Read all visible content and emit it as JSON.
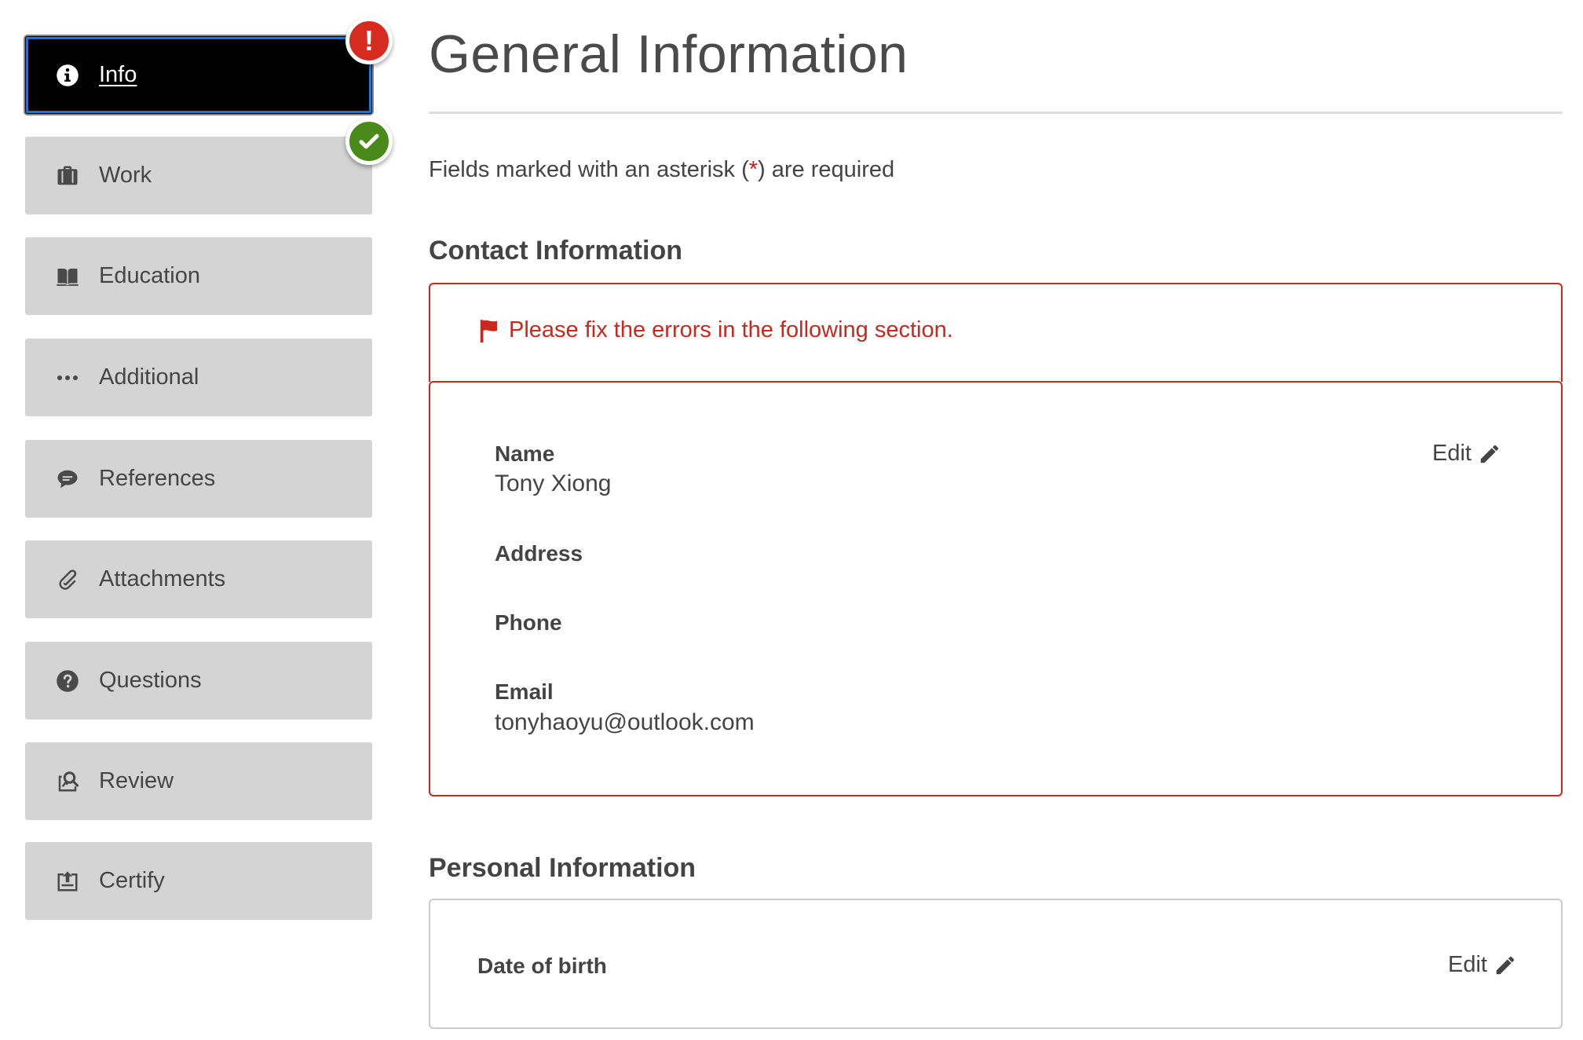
{
  "sidebar": {
    "items": [
      {
        "label": "Info",
        "icon": "info-icon",
        "state": "active"
      },
      {
        "label": "Work",
        "icon": "briefcase-icon"
      },
      {
        "label": "Education",
        "icon": "book-icon"
      },
      {
        "label": "Additional",
        "icon": "ellipsis-icon"
      },
      {
        "label": "References",
        "icon": "speech-bubble-icon"
      },
      {
        "label": "Attachments",
        "icon": "paperclip-icon"
      },
      {
        "label": "Questions",
        "icon": "question-circle-icon"
      },
      {
        "label": "Review",
        "icon": "review-icon"
      },
      {
        "label": "Certify",
        "icon": "certify-icon"
      }
    ],
    "badges": {
      "info": {
        "symbol": "!",
        "status": "error",
        "color": "#d62b1f"
      },
      "work": {
        "icon": "checkmark-icon",
        "status": "complete",
        "color": "#4a8a1a"
      }
    }
  },
  "main": {
    "title": "General Information",
    "required_note_before": "Fields marked with an asterisk (",
    "required_star": "*",
    "required_note_after": ") are required",
    "contact": {
      "heading": "Contact Information",
      "error_message": "Please fix the errors in the following section.",
      "edit_label": "Edit",
      "name_label": "Name",
      "name_value": "Tony Xiong",
      "address_label": "Address",
      "phone_label": "Phone",
      "email_label": "Email",
      "email_value": "tonyhaoyu@outlook.com"
    },
    "personal": {
      "heading": "Personal Information",
      "dob_label": "Date of birth",
      "edit_label": "Edit"
    }
  },
  "colors": {
    "error": "#c8281e",
    "nav_bg": "#d4d4d4",
    "nav_active_bg": "#000000",
    "focus_ring": "#1a73e8",
    "success": "#4a8a1a"
  }
}
